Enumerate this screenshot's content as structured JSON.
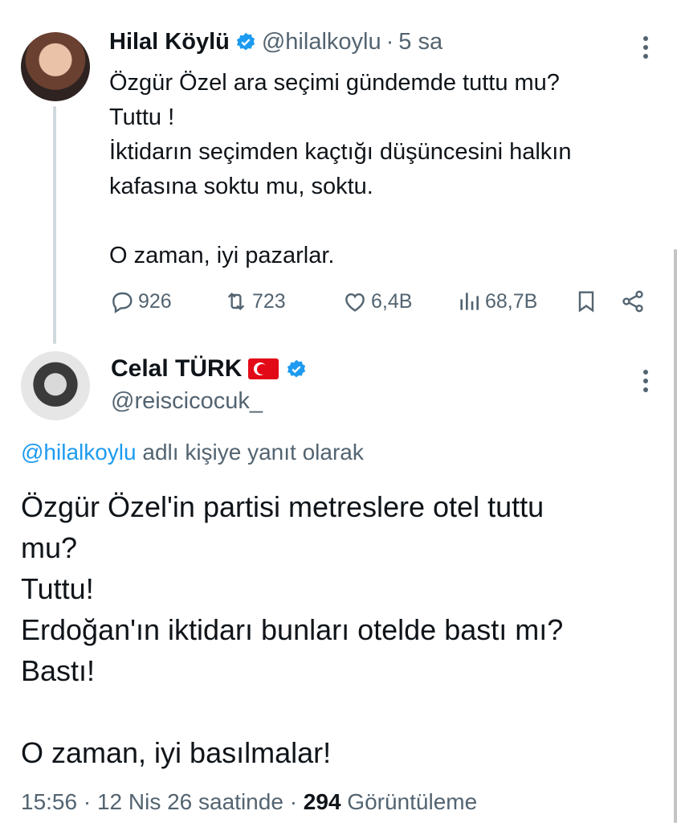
{
  "parent_tweet": {
    "name": "Hilal Köylü",
    "handle": "@hilalkoylu",
    "separator": "·",
    "time": "5 sa",
    "lines": [
      "Özgür Özel ara seçimi gündemde tuttu mu?",
      "Tuttu !",
      "İktidarın seçimden kaçtığı düşüncesini halkın",
      "kafasına soktu mu, soktu.",
      "",
      "O zaman, iyi pazarlar."
    ],
    "actions": {
      "replies": "926",
      "reposts": "723",
      "likes": "6,4B",
      "views": "68,7B"
    }
  },
  "reply_tweet": {
    "name": "Celal TÜRK",
    "handle": "@reiscicocuk_",
    "reply_to_mention": "@hilalkoylu",
    "reply_to_suffix": "adlı kişiye yanıt olarak",
    "lines": [
      "Özgür Özel'in partisi metreslere otel tuttu",
      "mu?",
      "Tuttu!",
      "Erdoğan'ın iktidarı bunları otelde bastı mı?",
      "Bastı!",
      "",
      "O zaman, iyi basılmalar!"
    ],
    "meta_time": "15:56",
    "meta_sep": "·",
    "meta_date": "12 Nis 26 saatinde",
    "meta_views_count": "294",
    "meta_views_label": "Görüntüleme"
  },
  "colors": {
    "verified": "#1d9bf0",
    "secondary_text": "#536471",
    "primary_text": "#0f1419",
    "mention": "#1d9bf0"
  }
}
